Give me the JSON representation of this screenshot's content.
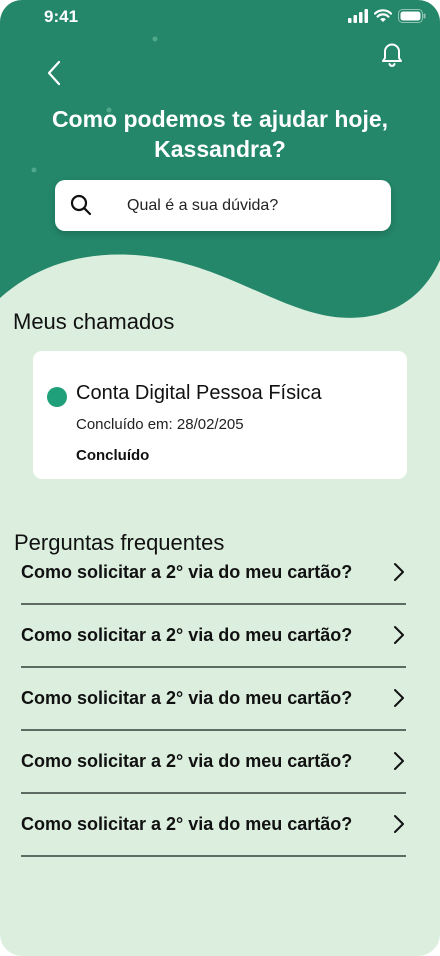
{
  "colors": {
    "header": "#24876a",
    "background": "#dcefdf",
    "accent_dot": "#1fa07a"
  },
  "status_bar": {
    "time": "9:41",
    "icons": [
      "signal-icon",
      "wifi-icon",
      "battery-icon"
    ]
  },
  "header": {
    "back_icon": "chevron-left-icon",
    "notification_icon": "bell-icon",
    "greeting": "Como podemos te ajudar hoje, Kassandra?"
  },
  "search": {
    "icon": "search-icon",
    "placeholder": "Qual é a sua dúvida?"
  },
  "tickets": {
    "section_title": "Meus chamados",
    "items": [
      {
        "title": "Conta Digital Pessoa Física",
        "date_text": "Concluído em: 28/02/205",
        "status": "Concluído"
      }
    ]
  },
  "faq": {
    "section_title": "Perguntas frequentes",
    "items": [
      {
        "question": "Como solicitar a 2° via do meu cartão?"
      },
      {
        "question": "Como solicitar a 2° via do meu cartão?"
      },
      {
        "question": "Como solicitar a 2° via do meu cartão?"
      },
      {
        "question": "Como solicitar a 2° via do meu cartão?"
      },
      {
        "question": "Como solicitar a 2° via do meu cartão?"
      }
    ]
  }
}
